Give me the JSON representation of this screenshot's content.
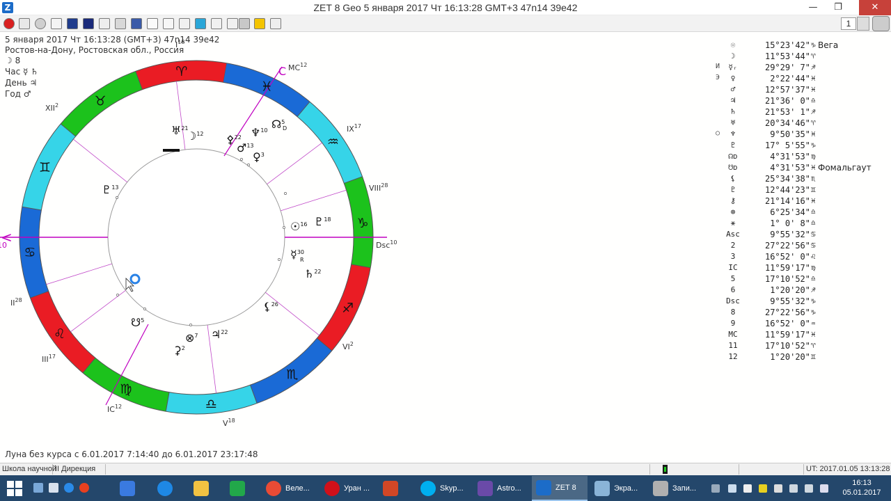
{
  "window": {
    "title": "ZET 8 Geo     5 января 2017   Чт   16:13:28 GMT+3  47n14  39e42",
    "minimize": "—",
    "maximize": "❐",
    "close": "✕"
  },
  "toolbar": {
    "chart_number": "1"
  },
  "header": {
    "line1": "5 января 2017   Чт   16:13:28 (GMT+3)  47n14  39e42",
    "line2": "Ростов-на-Дону, Ростовская обл., Россия",
    "moon_phase": "☽  8",
    "hour_lord": "Час ☿ ♄",
    "day_lord": "День ♃",
    "year_lord": "Год ♂"
  },
  "chart": {
    "signs": [
      "♈",
      "♉",
      "♊",
      "♋",
      "♌",
      "♍",
      "♎",
      "♏",
      "♐",
      "♑",
      "♒",
      "♓"
    ],
    "colors": {
      "fire": "#ea1c24",
      "earth": "#1cc21c",
      "air": "#36d4e8",
      "water": "#1a6ad6",
      "inner": "#aaaaaa",
      "axis": "#c000c0",
      "house": "#c048c8"
    },
    "house_labels": [
      {
        "num": "XII",
        "sup": "2"
      },
      {
        "num": "I",
        "sup": "18"
      },
      {
        "num": "MC",
        "sup": "12"
      },
      {
        "num": "IX",
        "sup": "17"
      },
      {
        "num": "VIII",
        "sup": "28"
      },
      {
        "num": "Dsc",
        "sup": "10"
      },
      {
        "num": "VI",
        "sup": "2"
      },
      {
        "num": "V",
        "sup": "18"
      },
      {
        "num": "IC",
        "sup": "12"
      },
      {
        "num": "III",
        "sup": "17"
      },
      {
        "num": "II",
        "sup": "28"
      },
      {
        "num": "10",
        "sup": ""
      }
    ],
    "planets": [
      {
        "glyph": "♅",
        "deg": "21"
      },
      {
        "glyph": "☽",
        "deg": "12"
      },
      {
        "glyph": "♆",
        "deg": "10"
      },
      {
        "glyph": "☊",
        "deg": "5"
      },
      {
        "glyph": "⚴",
        "deg": "22"
      },
      {
        "glyph": "♂",
        "deg": "13"
      },
      {
        "glyph": "♀",
        "deg": "3"
      },
      {
        "glyph": "☉",
        "deg": "16"
      },
      {
        "glyph": "♇",
        "deg": "18"
      },
      {
        "glyph": "☿",
        "deg": "30"
      },
      {
        "glyph": "♄",
        "deg": "22"
      },
      {
        "glyph": "⚸",
        "deg": "26"
      },
      {
        "glyph": "♃",
        "deg": "22"
      },
      {
        "glyph": "⊗",
        "deg": "7"
      },
      {
        "glyph": "☋",
        "deg": "5"
      },
      {
        "glyph": "⚳",
        "deg": "2"
      },
      {
        "glyph": "♇",
        "deg": "13"
      }
    ],
    "retro": "R",
    "direct": "D"
  },
  "positions": [
    {
      "mark": "",
      "sym": "☉",
      "deg": "15°23'42\"",
      "sign": "♑",
      "star": "Вега"
    },
    {
      "mark": "",
      "sym": "☽",
      "deg": "11°53'44\"",
      "sign": "♈",
      "star": ""
    },
    {
      "mark": "И",
      "sym": "☿ᵣ",
      "deg": "29°29' 7\"",
      "sign": "♐",
      "star": ""
    },
    {
      "mark": "Э",
      "sym": "♀",
      "deg": "2°22'44\"",
      "sign": "♓",
      "star": ""
    },
    {
      "mark": "",
      "sym": "♂",
      "deg": "12°57'37\"",
      "sign": "♓",
      "star": ""
    },
    {
      "mark": "",
      "sym": "♃",
      "deg": "21°36' 0\"",
      "sign": "♎",
      "star": ""
    },
    {
      "mark": "",
      "sym": "♄",
      "deg": "21°53' 1\"",
      "sign": "♐",
      "star": ""
    },
    {
      "mark": "",
      "sym": "♅",
      "deg": "20°34'46\"",
      "sign": "♈",
      "star": ""
    },
    {
      "mark": "○",
      "sym": "♆",
      "deg": "9°50'35\"",
      "sign": "♓",
      "star": ""
    },
    {
      "mark": "",
      "sym": "♇",
      "deg": "17° 5'55\"",
      "sign": "♑",
      "star": ""
    },
    {
      "mark": "",
      "sym": "☊ᴅ",
      "deg": "4°31'53\"",
      "sign": "♍",
      "star": ""
    },
    {
      "mark": "",
      "sym": "☋ᴅ",
      "deg": "4°31'53\"",
      "sign": "♓",
      "star": "Фомальгаут"
    },
    {
      "mark": "",
      "sym": "⚸",
      "deg": "25°34'38\"",
      "sign": "♏",
      "star": ""
    },
    {
      "mark": "",
      "sym": "♇",
      "deg": "12°44'23\"",
      "sign": "♊",
      "star": ""
    },
    {
      "mark": "",
      "sym": "⚷",
      "deg": "21°14'16\"",
      "sign": "♓",
      "star": ""
    },
    {
      "mark": "",
      "sym": "⊗",
      "deg": "6°25'34\"",
      "sign": "♎",
      "star": ""
    },
    {
      "mark": "",
      "sym": "⚹",
      "deg": "1° 0' 8\"",
      "sign": "♎",
      "star": ""
    },
    {
      "mark": "",
      "sym": "Asc",
      "deg": "9°55'32\"",
      "sign": "♋",
      "star": ""
    },
    {
      "mark": "",
      "sym": "2",
      "deg": "27°22'56\"",
      "sign": "♋",
      "star": ""
    },
    {
      "mark": "",
      "sym": "3",
      "deg": "16°52' 0\"",
      "sign": "♌",
      "star": ""
    },
    {
      "mark": "",
      "sym": "IC",
      "deg": "11°59'17\"",
      "sign": "♍",
      "star": ""
    },
    {
      "mark": "",
      "sym": "5",
      "deg": "17°10'52\"",
      "sign": "♎",
      "star": ""
    },
    {
      "mark": "",
      "sym": "6",
      "deg": "1°20'20\"",
      "sign": "♐",
      "star": ""
    },
    {
      "mark": "",
      "sym": "Dsc",
      "deg": "9°55'32\"",
      "sign": "♑",
      "star": ""
    },
    {
      "mark": "",
      "sym": "8",
      "deg": "27°22'56\"",
      "sign": "♑",
      "star": ""
    },
    {
      "mark": "",
      "sym": "9",
      "deg": "16°52' 0\"",
      "sign": "♒",
      "star": ""
    },
    {
      "mark": "",
      "sym": "MC",
      "deg": "11°59'17\"",
      "sign": "♓",
      "star": ""
    },
    {
      "mark": "",
      "sym": "11",
      "deg": "17°10'52\"",
      "sign": "♈",
      "star": ""
    },
    {
      "mark": "",
      "sym": "12",
      "deg": "1°20'20\"",
      "sign": "♊",
      "star": ""
    }
  ],
  "note": "Луна без курса с 6.01.2017  7:14:40 до 6.01.2017 23:17:48",
  "status": {
    "cell1": "Школа научной",
    "cell2": "II Дирекция",
    "ut": "UT: 2017.01.05 13:13:28"
  },
  "taskbar": {
    "items": [
      "Веле...",
      "Уран ...",
      "",
      "Skyp...",
      "Astro...",
      "ZET 8",
      "Экра...",
      "Запи..."
    ],
    "time": "16:13",
    "date": "05.01.2017"
  }
}
